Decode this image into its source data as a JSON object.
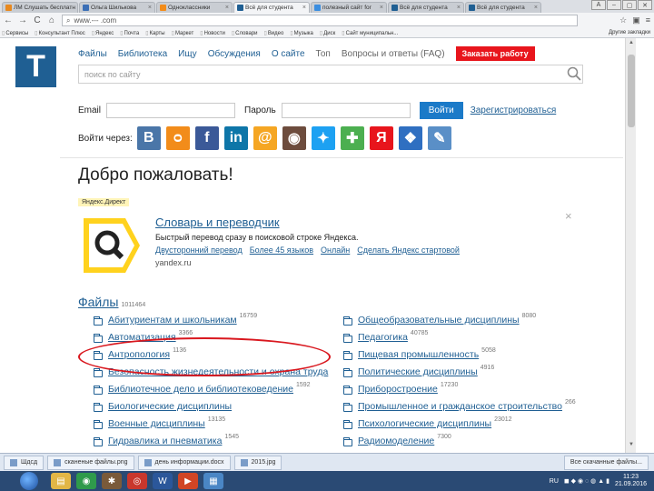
{
  "browser": {
    "tabs": [
      {
        "label": "ЛМ Слушать бесплатн",
        "color": "#e8891f",
        "active": false
      },
      {
        "label": "Ольга Шилькова",
        "color": "#3b6fb6",
        "active": false
      },
      {
        "label": "Одноклассники",
        "color": "#f28c1a",
        "active": false
      },
      {
        "label": "Всё для студента",
        "color": "#1f5f93",
        "active": true
      },
      {
        "label": "полезный сайт for",
        "color": "#3b8ee0",
        "active": false
      },
      {
        "label": "Всё для студента",
        "color": "#1f5f93",
        "active": false
      },
      {
        "label": "Всё для студента",
        "color": "#1f5f93",
        "active": false
      }
    ],
    "address": "www.--- .com",
    "bookmarks": [
      "Сервисы",
      "Консультант Плюс",
      "Яндекс",
      "Почта",
      "Карты",
      "Маркет",
      "Новости",
      "Словари",
      "Видео",
      "Музыка",
      "Диск",
      "Сайт муниципальн..."
    ],
    "bookmarks_right": "Другие закладки"
  },
  "site": {
    "logo": "T",
    "nav": [
      "Файлы",
      "Библиотека",
      "Ищу",
      "Обсуждения",
      "О сайте",
      "Топ",
      "Вопросы и ответы (FAQ)"
    ],
    "order_button": "Заказать работу",
    "search_placeholder": "поиск по сайту",
    "email_label": "Email",
    "password_label": "Пароль",
    "login_button": "Войти",
    "register_link": "Зарегистрироваться",
    "login_via": "Войти через:",
    "social": [
      {
        "name": "vkontakte",
        "glyph": "В",
        "color": "#4a76a8"
      },
      {
        "name": "odnoklassniki",
        "glyph": "ᴑ",
        "color": "#f28c1a"
      },
      {
        "name": "facebook",
        "glyph": "f",
        "color": "#3b5998"
      },
      {
        "name": "linkedin",
        "glyph": "in",
        "color": "#0e76a8"
      },
      {
        "name": "mailru",
        "glyph": "@",
        "color": "#f5a623"
      },
      {
        "name": "instagram",
        "glyph": "◉",
        "color": "#6d4c3d"
      },
      {
        "name": "twitter",
        "glyph": "✦",
        "color": "#1da1f2"
      },
      {
        "name": "google",
        "glyph": "✚",
        "color": "#4caf50"
      },
      {
        "name": "yandex",
        "glyph": "Я",
        "color": "#e8151c"
      },
      {
        "name": "windows-live",
        "glyph": "❖",
        "color": "#2f6fc1"
      },
      {
        "name": "openid",
        "glyph": "✎",
        "color": "#5a8fc7"
      }
    ],
    "welcome": "Добро пожаловать!",
    "ad": {
      "label": "Яндекс.Директ",
      "title": "Словарь и переводчик",
      "desc": "Быстрый перевод сразу в поисковой строке Яндекса.",
      "links": [
        "Двусторонний перевод",
        "Более 45 языков",
        "Онлайн",
        "Сделать Яндекс стартовой"
      ],
      "site": "yandex.ru",
      "close": "×"
    },
    "files_title": "Файлы",
    "files_count": "1011464",
    "files_left": [
      {
        "name": "Абитуриентам и школьникам",
        "count": "16759"
      },
      {
        "name": "Автоматизация",
        "count": "3366"
      },
      {
        "name": "Антропология",
        "count": "1136"
      },
      {
        "name": "Безопасность жизнедеятельности и охрана труда",
        "count": ""
      },
      {
        "name": "Библиотечное дело и библиотековедение",
        "count": "1592"
      },
      {
        "name": "Биологические дисциплины",
        "count": ""
      },
      {
        "name": "Военные дисциплины",
        "count": "13135"
      },
      {
        "name": "Гидравлика и пневматика",
        "count": "1545"
      }
    ],
    "files_right": [
      {
        "name": "Общеобразовательные дисциплины",
        "count": "8080"
      },
      {
        "name": "Педагогика",
        "count": "40785"
      },
      {
        "name": "Пищевая промышленность",
        "count": "5058"
      },
      {
        "name": "Политические дисциплины",
        "count": "4916"
      },
      {
        "name": "Приборостроение",
        "count": "17230"
      },
      {
        "name": "Промышленное и гражданское строительство",
        "count": "266"
      },
      {
        "name": "Психологические дисциплины",
        "count": "23012"
      },
      {
        "name": "Радиомоделение",
        "count": "7300"
      }
    ]
  },
  "taskbar": {
    "apps": [
      "Шдсд",
      "сканеные файлы.png",
      "день информации.docx",
      "2015.jpg"
    ],
    "right_app": "Все скачанные файлы...",
    "tray_lang": "RU",
    "clock_time": "11:23",
    "clock_date": "21.09.2016"
  }
}
